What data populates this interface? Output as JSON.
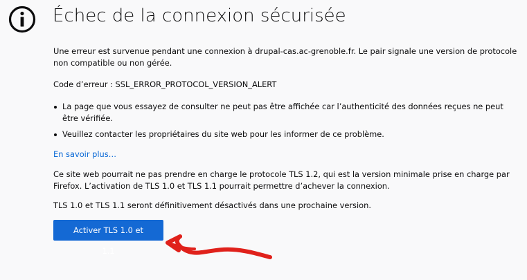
{
  "header": {
    "icon": "info-icon",
    "title": "Échec de la connexion sécurisée"
  },
  "main": {
    "description": "Une erreur est survenue pendant une connexion à drupal-cas.ac-grenoble.fr. Le pair signale une version de protocole non compatible ou non gérée.",
    "error_code": "Code d’erreur : SSL_ERROR_PROTOCOL_VERSION_ALERT",
    "bullets": [
      "La page que vous essayez de consulter ne peut pas être affichée car l’authenticité des données reçues ne peut être vérifiée.",
      "Veuillez contacter les propriétaires du site web pour les informer de ce problème."
    ],
    "learn_more": "En savoir plus…",
    "tls_notice": "Ce site web pourrait ne pas prendre en charge le protocole TLS 1.2, qui est la version minimale prise en charge par Firefox. L’activation de TLS 1.0 et TLS 1.1 pourrait permettre d’achever la connexion.",
    "deprecation_notice": "TLS 1.0 et TLS 1.1 seront définitivement désactivés dans une prochaine version.",
    "enable_button_label": "Activer TLS 1.0 et 1.1"
  },
  "colors": {
    "background": "#f9f9fa",
    "link": "#0a69d6",
    "button": "#1469d4",
    "annotation": "#e0211b"
  }
}
